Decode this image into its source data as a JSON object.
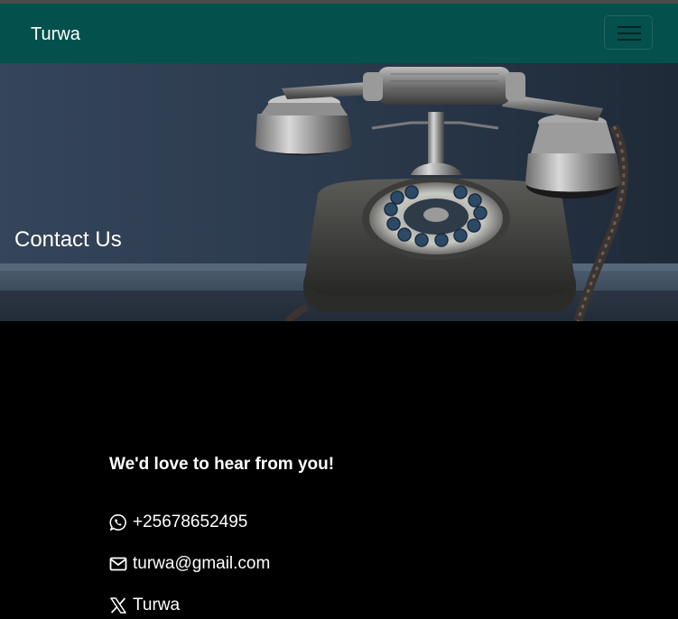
{
  "navbar": {
    "brand": "Turwa",
    "toggler_icon": "hamburger-icon",
    "background_color": "#04504d"
  },
  "hero": {
    "title": "Contact Us",
    "image": "vintage-rotary-telephone"
  },
  "contact": {
    "heading": "We'd love to hear from you!",
    "items": [
      {
        "icon": "whatsapp-icon",
        "text": "+25678652495"
      },
      {
        "icon": "envelope-icon",
        "text": "turwa@gmail.com"
      },
      {
        "icon": "x-logo-icon",
        "text": "Turwa"
      }
    ]
  },
  "colors": {
    "page_background": "#000000",
    "text": "#ffffff"
  }
}
